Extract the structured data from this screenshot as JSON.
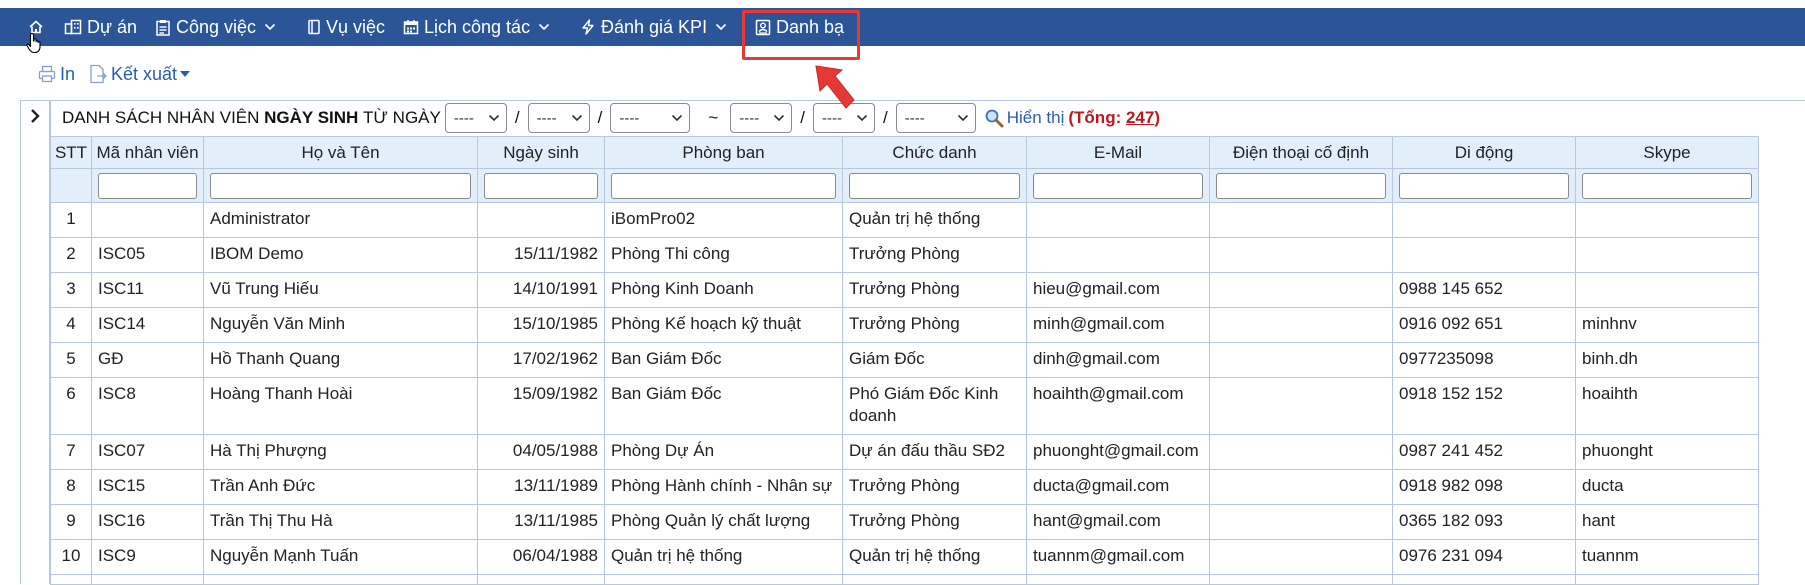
{
  "nav": {
    "items": [
      {
        "key": "home",
        "label": "",
        "icon": "home-icon"
      },
      {
        "key": "du-an",
        "label": "Dự án",
        "icon": "building-icon"
      },
      {
        "key": "cong-viec",
        "label": "Công việc",
        "icon": "clipboard-icon",
        "dropdown": true
      },
      {
        "key": "vu-viec",
        "label": "Vụ việc",
        "icon": "book-icon"
      },
      {
        "key": "lich-cong-tac",
        "label": "Lịch công tác",
        "icon": "calendar-icon",
        "dropdown": true
      },
      {
        "key": "danh-gia-kpi",
        "label": "Đánh giá KPI",
        "icon": "bolt-icon",
        "dropdown": true
      },
      {
        "key": "danh-ba",
        "label": "Danh bạ",
        "icon": "contact-card-icon",
        "active": true
      }
    ]
  },
  "toolbar": {
    "print_label": "In",
    "export_label": "Kết xuất"
  },
  "filter": {
    "prefix": "DANH SÁCH NHÂN VIÊN",
    "bold": "NGÀY SINH",
    "from_label": "TỪ NGÀY",
    "slash": "/",
    "tilde": "~",
    "placeholder": "----",
    "show_label": "Hiển thị",
    "total_open": "(Tổng:",
    "total_value": "247",
    "total_close": ")"
  },
  "table": {
    "columns": [
      "STT",
      "Mã nhân viên",
      "Họ và Tên",
      "Ngày sinh",
      "Phòng ban",
      "Chức danh",
      "E-Mail",
      "Điện thoại cố định",
      "Di động",
      "Skype"
    ],
    "rows": [
      {
        "stt": "1",
        "ma": "",
        "ten": "Administrator",
        "ngay": "",
        "phong": "iBomPro02",
        "chuc": "Quản trị hệ thống",
        "email": "",
        "dtcd": "",
        "didong": "",
        "skype": ""
      },
      {
        "stt": "2",
        "ma": "ISC05",
        "ten": "IBOM Demo",
        "ngay": "15/11/1982",
        "phong": "Phòng Thi công",
        "chuc": "Trưởng Phòng",
        "email": "",
        "dtcd": "",
        "didong": "",
        "skype": ""
      },
      {
        "stt": "3",
        "ma": "ISC11",
        "ten": "Vũ Trung Hiếu",
        "ngay": "14/10/1991",
        "phong": "Phòng Kinh Doanh",
        "chuc": "Trưởng Phòng",
        "email": "hieu@gmail.com",
        "dtcd": "",
        "didong": "0988 145 652",
        "skype": ""
      },
      {
        "stt": "4",
        "ma": "ISC14",
        "ten": "Nguyễn Văn Minh",
        "ngay": "15/10/1985",
        "phong": "Phòng Kế hoạch kỹ thuật",
        "chuc": "Trưởng Phòng",
        "email": "minh@gmail.com",
        "dtcd": "",
        "didong": "0916 092 651",
        "skype": "minhnv"
      },
      {
        "stt": "5",
        "ma": "GĐ",
        "ten": "Hồ Thanh Quang",
        "ngay": "17/02/1962",
        "phong": "Ban Giám Đốc",
        "chuc": "Giám Đốc",
        "email": "dinh@gmail.com",
        "dtcd": "",
        "didong": "0977235098",
        "skype": "binh.dh"
      },
      {
        "stt": "6",
        "ma": "ISC8",
        "ten": "Hoàng Thanh Hoài",
        "ngay": "15/09/1982",
        "phong": "Ban Giám Đốc",
        "chuc": "Phó Giám Đốc Kinh doanh",
        "email": "hoaihth@gmail.com",
        "dtcd": "",
        "didong": "0918 152 152",
        "skype": "hoaihth"
      },
      {
        "stt": "7",
        "ma": "ISC07",
        "ten": "Hà Thị Phượng",
        "ngay": "04/05/1988",
        "phong": "Phòng Dự Án",
        "chuc": "Dự án đấu thầu SĐ2",
        "email": "phuonght@gmail.com",
        "dtcd": "",
        "didong": "0987 241 452",
        "skype": "phuonght"
      },
      {
        "stt": "8",
        "ma": "ISC15",
        "ten": "Trần Anh Đức",
        "ngay": "13/11/1989",
        "phong": "Phòng Hành chính - Nhân sự",
        "chuc": "Trưởng Phòng",
        "email": "ducta@gmail.com",
        "dtcd": "",
        "didong": "0918 982 098",
        "skype": "ducta"
      },
      {
        "stt": "9",
        "ma": "ISC16",
        "ten": "Trần Thị Thu Hà",
        "ngay": "13/11/1985",
        "phong": "Phòng Quản lý chất lượng",
        "chuc": "Trưởng Phòng",
        "email": "hant@gmail.com",
        "dtcd": "",
        "didong": "0365 182 093",
        "skype": "hant"
      },
      {
        "stt": "10",
        "ma": "ISC9",
        "ten": "Nguyễn Mạnh Tuấn",
        "ngay": "06/04/1988",
        "phong": "Quản trị hệ thống",
        "chuc": "Quản trị hệ thống",
        "email": "tuannm@gmail.com",
        "dtcd": "",
        "didong": "0976 231 094",
        "skype": "tuannm"
      }
    ]
  },
  "colors": {
    "nav_bg": "#2b5597",
    "header_bg": "#e3eefb",
    "link": "#2a5db0",
    "accent_red": "#e53935",
    "total_red": "#c0161c"
  }
}
